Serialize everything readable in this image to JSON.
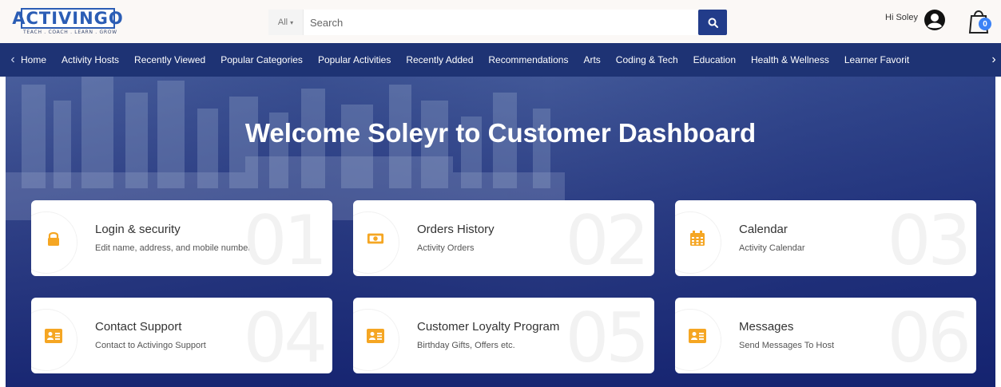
{
  "header": {
    "logo_text": "ACTIVINGO",
    "logo_tagline": "TEACH . COACH . LEARN . GROW",
    "search_category": "All",
    "search_placeholder": "Search",
    "greeting": "Hi Soley",
    "cart_count": "0"
  },
  "nav": {
    "items": [
      "Home",
      "Activity Hosts",
      "Recently Viewed",
      "Popular Categories",
      "Popular Activities",
      "Recently Added",
      "Recommendations",
      "Arts",
      "Coding & Tech",
      "Education",
      "Health & Wellness",
      "Learner Favorit"
    ]
  },
  "hero": {
    "title": "Welcome Soleyr to Customer Dashboard"
  },
  "cards": [
    {
      "title": "Login & security",
      "subtitle": "Edit name, address, and mobile number",
      "number": "01",
      "icon": "lock-icon"
    },
    {
      "title": "Orders History",
      "subtitle": "Activity Orders",
      "number": "02",
      "icon": "money-icon"
    },
    {
      "title": "Calendar",
      "subtitle": "Activity Calendar",
      "number": "03",
      "icon": "calendar-icon"
    },
    {
      "title": "Contact Support",
      "subtitle": "Contact to Activingo Support",
      "number": "04",
      "icon": "contact-card-icon"
    },
    {
      "title": "Customer Loyalty Program",
      "subtitle": "Birthday Gifts, Offers etc.",
      "number": "05",
      "icon": "contact-card-icon"
    },
    {
      "title": "Messages",
      "subtitle": "Send Messages To Host",
      "number": "06",
      "icon": "contact-card-icon"
    }
  ],
  "colors": {
    "accent_navy": "#1e3374",
    "search_button": "#223c8a",
    "icon_orange": "#f5a623",
    "badge_blue": "#3b82f6"
  }
}
